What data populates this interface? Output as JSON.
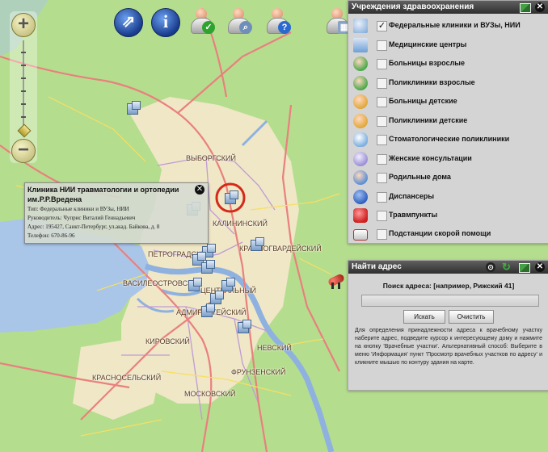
{
  "colors": {
    "water": "#a9c5e8",
    "land": "#b5dd8e",
    "urban": "#efe7c6",
    "road_major": "#e9807e",
    "road_minor": "#f8f1a6",
    "panel_header": "#3f3f3f",
    "highlight_ring": "#d42a1a"
  },
  "toolbar": {
    "buttons": [
      {
        "name": "compass-icon",
        "glyph": "⇗"
      },
      {
        "name": "info-icon",
        "glyph": "i"
      },
      {
        "name": "person-check-icon",
        "glyph": "✓"
      },
      {
        "name": "person-search-icon",
        "glyph": "⌕"
      },
      {
        "name": "person-help-icon",
        "glyph": "?"
      },
      {
        "name": "person-settings-icon",
        "glyph": "▦"
      }
    ]
  },
  "layers_panel": {
    "title": "Учреждения здравоохранения",
    "items": [
      {
        "label": "Федеральные клиники и ВУЗы, НИИ",
        "checked": true,
        "icon": "federal-clinic-icon",
        "color": "#7aa6d8"
      },
      {
        "label": "Медицинские центры",
        "checked": false,
        "icon": "medical-center-icon",
        "color": "#6d9fd6"
      },
      {
        "label": "Больницы взрослые",
        "checked": false,
        "icon": "adult-hospital-icon",
        "color": "#4aa84a"
      },
      {
        "label": "Поликлиники взрослые",
        "checked": false,
        "icon": "adult-polyclinic-icon",
        "color": "#4aa84a"
      },
      {
        "label": "Больницы детские",
        "checked": false,
        "icon": "children-hospital-icon",
        "color": "#e0a73a"
      },
      {
        "label": "Поликлиники детские",
        "checked": false,
        "icon": "children-polyclinic-icon",
        "color": "#e0a73a"
      },
      {
        "label": "Стоматологические поликлиники",
        "checked": false,
        "icon": "dental-icon",
        "color": "#7eb0e0"
      },
      {
        "label": "Женские консультации",
        "checked": false,
        "icon": "womens-clinic-icon",
        "color": "#9b8fd6"
      },
      {
        "label": "Родильные дома",
        "checked": false,
        "icon": "maternity-icon",
        "color": "#5b8ed3"
      },
      {
        "label": "Диспансеры",
        "checked": false,
        "icon": "dispensary-icon",
        "color": "#2f5fbf"
      },
      {
        "label": "Травмпункты",
        "checked": false,
        "icon": "trauma-icon",
        "color": "#d02020"
      },
      {
        "label": "Подстанции скорой помощи",
        "checked": false,
        "icon": "ambulance-icon",
        "color": "#d8d8d8"
      }
    ]
  },
  "address_panel": {
    "title": "Найти адрес",
    "search_label": "Поиск адреса: [например, Рижский 41]",
    "search_value": "",
    "find_button": "Искать",
    "clear_button": "Очистить",
    "help_text": "Для определения принадлежности адреса к врачебному участку наберите адрес, подведите курсор к интересующему дому и нажмите на кнопку 'Врачебные участки'. Альтернативный способ: Выберите в меню 'Информация' пункт 'Просмотр врачебных участков по адресу' и кликните мышью по контуру здания на карте."
  },
  "popup": {
    "title": "Клиника НИИ травматологии и ортопедии им.Р.Р.Вредена",
    "line1": "Тип: Федеральные клиники и ВУЗы, НИИ",
    "line2": "Руководитель: Чуприс Виталий Геннадьевич",
    "line3": "Адрес: 195427, Санкт-Петербург, ул.акад. Байкова, д. 8",
    "line4": "Телефон: 670-86-96"
  },
  "districts": [
    {
      "label": "ВЫБОРГСКИЙ",
      "cls": "d1"
    },
    {
      "label": "КАЛИНИНСКИЙ",
      "cls": "d2"
    },
    {
      "label": "КРАСНОГВАРДЕЙСКИЙ",
      "cls": "d3"
    },
    {
      "label": "ПЕТРОГРАДСКИЙ",
      "cls": "d4"
    },
    {
      "label": "ВАСИЛЕОСТРОВСКИЙ",
      "cls": "d5"
    },
    {
      "label": "ЦЕНТРАЛЬНЫЙ",
      "cls": "d6"
    },
    {
      "label": "АДМИРАЛТЕЙСКИЙ",
      "cls": "d7"
    },
    {
      "label": "КИРОВСКИЙ",
      "cls": "d8"
    },
    {
      "label": "НЕВСКИЙ",
      "cls": "d9"
    },
    {
      "label": "ФРУНЗЕНСКИЙ",
      "cls": "d10"
    },
    {
      "label": "КРАСНОСЕЛЬСКИЙ",
      "cls": "d11"
    },
    {
      "label": "МОСКОВСКИЙ",
      "cls": "d12"
    }
  ]
}
